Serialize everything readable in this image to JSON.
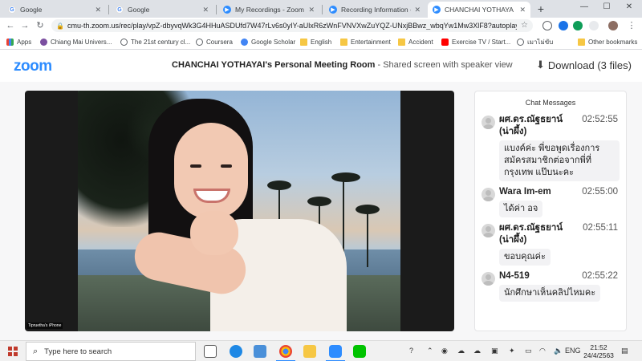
{
  "browser": {
    "tabs": [
      {
        "title": "Google",
        "icon": "google-icon"
      },
      {
        "title": "Google",
        "icon": "google-icon"
      },
      {
        "title": "My Recordings - Zoom",
        "icon": "zoom-icon"
      },
      {
        "title": "Recording Information - Zo",
        "icon": "zoom-icon"
      },
      {
        "title": "CHANCHAI YOTHAYA",
        "icon": "zoom-icon"
      }
    ],
    "address": "cmu-th.zoom.us/rec/play/vpZ-dbyvqWk3G4HHuASDUfd7W47rLv6s0yIY-aUlxR6zWnFVNVXwZuYQZ-UNxjBBwz_wbqYw1Mw3XlF8?autoplay=t...",
    "bookmarks": [
      {
        "label": "Apps",
        "icon": "apps-icon"
      },
      {
        "label": "Chiang Mai Univers...",
        "icon": "cmu-icon"
      },
      {
        "label": "The 21st century cl...",
        "icon": "web-icon"
      },
      {
        "label": "Coursera",
        "icon": "web-icon"
      },
      {
        "label": "Google Scholar",
        "icon": "scholar-icon"
      },
      {
        "label": "English",
        "icon": "folder-icon"
      },
      {
        "label": "Entertainment",
        "icon": "folder-icon"
      },
      {
        "label": "Accident",
        "icon": "folder-icon"
      },
      {
        "label": "Exercise TV / Start...",
        "icon": "youtube-icon"
      },
      {
        "label": "เมาไม่ขับ",
        "icon": "web-icon"
      },
      {
        "label": "Other bookmarks",
        "icon": "folder-icon"
      }
    ]
  },
  "zoom": {
    "logo": "zoom",
    "meeting_host": "CHANCHAI YOTHAYAI's Personal Meeting Room",
    "meeting_sub": " - Shared screen with speaker view",
    "download_label": "Download (3 files)"
  },
  "video": {
    "camera_label": "Tipruetha's iPhone"
  },
  "chat": {
    "title": "Chat Messages",
    "messages": [
      {
        "sender": "ผศ.ดร.ณัฐธยาน์ (น่าผึ้ง)",
        "time": "02:52:55",
        "text": "แบงค์ค่ะ พี่ขอพูดเรื่องการสมัครสมาชิกต่อจากพี่ที่กรุงเทพ แป๊บนะคะ"
      },
      {
        "sender": "Wara Im-em",
        "time": "02:55:00",
        "text": "ได้ค่า อจ"
      },
      {
        "sender": "ผศ.ดร.ณัฐธยาน์ (น่าผึ้ง)",
        "time": "02:55:11",
        "text": "ขอบคุณค่ะ"
      },
      {
        "sender": "N4-519",
        "time": "02:55:22",
        "text": "นักศึกษาเห็นคลิปไหมคะ"
      }
    ]
  },
  "taskbar": {
    "search_placeholder": "Type here to search",
    "language": "ENG",
    "time": "21:52",
    "date": "24/4/2563"
  },
  "colors": {
    "zoom_blue": "#2d8cff",
    "tab_strip": "#dee1e6",
    "chat_bubble": "#f2f2f4"
  }
}
